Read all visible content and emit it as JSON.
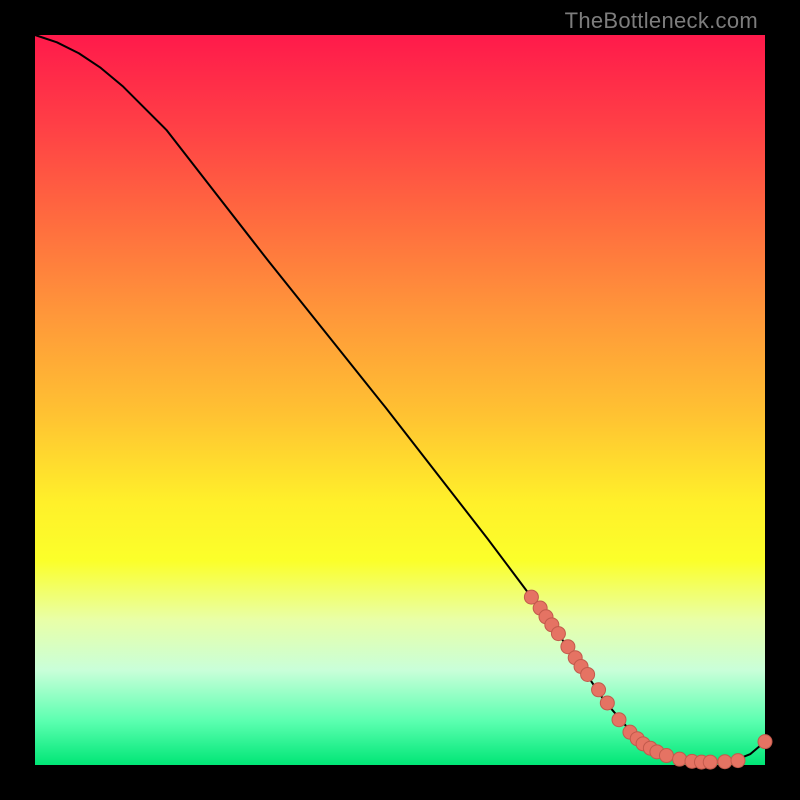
{
  "watermark": "TheBottleneck.com",
  "colors": {
    "curve": "#000000",
    "dot_fill": "#e57363",
    "dot_stroke": "#c25a4c"
  },
  "chart_data": {
    "type": "line",
    "title": "",
    "xlabel": "",
    "ylabel": "",
    "xlim": [
      0,
      100
    ],
    "ylim": [
      0,
      100
    ],
    "series": [
      {
        "name": "curve",
        "x": [
          0,
          3,
          6,
          9,
          12,
          18,
          25,
          32,
          40,
          48,
          55,
          62,
          68,
          72,
          75.5,
          78,
          81,
          84,
          87,
          90,
          93,
          96,
          98,
          100
        ],
        "y": [
          100,
          99,
          97.5,
          95.5,
          93,
          87,
          78,
          69,
          59,
          49,
          40,
          31,
          23,
          17.5,
          12.5,
          8.8,
          5.3,
          2.8,
          1.3,
          0.6,
          0.4,
          0.7,
          1.5,
          3.2
        ]
      }
    ],
    "dots": {
      "name": "data-points",
      "x": [
        68,
        69.2,
        70,
        70.8,
        71.7,
        73,
        74,
        74.8,
        75.7,
        77.2,
        78.4,
        80.0,
        81.5,
        82.5,
        83.3,
        84.3,
        85.2,
        86.5,
        88.3,
        90.0,
        91.3,
        92.5,
        94.5,
        96.3,
        100
      ],
      "y": [
        23,
        21.5,
        20.3,
        19.2,
        18,
        16.2,
        14.7,
        13.5,
        12.4,
        10.3,
        8.5,
        6.2,
        4.5,
        3.6,
        2.9,
        2.3,
        1.8,
        1.3,
        0.8,
        0.5,
        0.4,
        0.4,
        0.45,
        0.6,
        3.2
      ]
    }
  }
}
